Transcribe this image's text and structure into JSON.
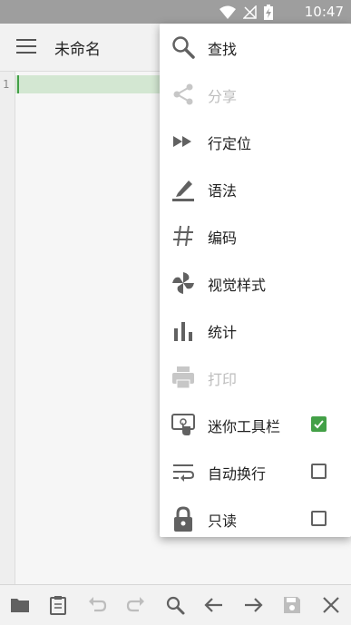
{
  "status_bar": {
    "time": "10:47",
    "wifi_icon": "wifi-icon",
    "signal_icon": "signal-off-icon",
    "battery_icon": "battery-charging-icon"
  },
  "app_bar": {
    "title": "未命名",
    "menu_icon": "hamburger-menu-icon"
  },
  "editor": {
    "line_numbers": [
      "1"
    ]
  },
  "overflow_menu": {
    "items": [
      {
        "label": "查找",
        "icon": "search-icon",
        "enabled": true
      },
      {
        "label": "分享",
        "icon": "share-icon",
        "enabled": false
      },
      {
        "label": "行定位",
        "icon": "fast-forward-icon",
        "enabled": true
      },
      {
        "label": "语法",
        "icon": "pen-icon",
        "enabled": true
      },
      {
        "label": "编码",
        "icon": "hash-icon",
        "enabled": true
      },
      {
        "label": "视觉样式",
        "icon": "pinwheel-icon",
        "enabled": true
      },
      {
        "label": "统计",
        "icon": "bar-chart-icon",
        "enabled": true
      },
      {
        "label": "打印",
        "icon": "printer-icon",
        "enabled": false
      },
      {
        "label": "迷你工具栏",
        "icon": "touch-screen-icon",
        "enabled": true,
        "checked": true
      },
      {
        "label": "自动换行",
        "icon": "wrap-icon",
        "enabled": true,
        "checked": false
      },
      {
        "label": "只读",
        "icon": "lock-icon",
        "enabled": true,
        "checked": false
      }
    ]
  },
  "bottom_toolbar": [
    "folder-icon",
    "clipboard-icon",
    "undo-icon",
    "redo-icon",
    "search-icon",
    "arrow-left-icon",
    "arrow-right-icon",
    "save-icon",
    "close-icon"
  ],
  "colors": {
    "accent": "#43a047",
    "current_line": "#d3e7d2",
    "status_bar": "#9e9e9e"
  }
}
